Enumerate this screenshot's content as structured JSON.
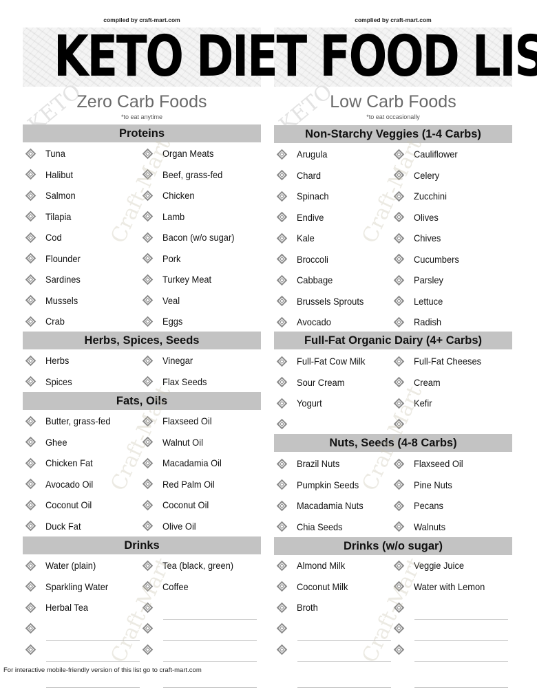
{
  "title": "KETO DIET FOOD LIST",
  "compiled_left": "compiled by craft-mart.com",
  "compiled_right": "complied by craft-mart.com",
  "watermark": "Craft-Mart",
  "keto_watermark": "KETO",
  "footer_note": "For interactive mobile-friendly version of this list go to craft-mart.com",
  "left": {
    "subtitle": "Zero Carb Foods",
    "note": "*to eat anytime",
    "sections": [
      {
        "title": "Proteins",
        "col1": [
          "Tuna",
          "Halibut",
          "Salmon",
          "Tilapia",
          "Cod",
          "Flounder",
          "Sardines",
          "Mussels",
          "Crab"
        ],
        "col2": [
          "Organ Meats",
          "Beef, grass-fed",
          "Chicken",
          "Lamb",
          "Bacon  (w/o sugar)",
          "Pork",
          "Turkey Meat",
          "Veal",
          "Eggs"
        ]
      },
      {
        "title": "Herbs, Spices, Seeds",
        "col1": [
          "Herbs",
          "Spices"
        ],
        "col2": [
          "Vinegar",
          "Flax Seeds"
        ]
      },
      {
        "title": "Fats, Oils",
        "col1": [
          "Butter, grass-fed",
          "Ghee",
          "Chicken Fat",
          "Avocado Oil",
          "Coconut Oil",
          "Duck Fat"
        ],
        "col2": [
          "Flaxseed Oil",
          "Walnut Oil",
          "Macadamia Oil",
          "Red Palm Oil",
          "Coconut Oil",
          "Olive Oil"
        ]
      },
      {
        "title": "Drinks",
        "col1": [
          "Water (plain)",
          "Sparkling Water",
          "Herbal Tea",
          "",
          ""
        ],
        "col2": [
          "Tea (black, green)",
          "Coffee",
          "",
          "",
          ""
        ]
      }
    ]
  },
  "right": {
    "subtitle": "Low Carb Foods",
    "note": "*to eat occasionally",
    "sections": [
      {
        "title": "Non-Starchy Veggies (1-4 Carbs)",
        "col1": [
          "Arugula",
          "Chard",
          "Spinach",
          "Endive",
          "Kale",
          "Broccoli",
          "Cabbage",
          "Brussels Sprouts",
          "Avocado"
        ],
        "col2": [
          "Cauliflower",
          "Celery",
          "Zucchini",
          "Olives",
          "Chives",
          "Cucumbers",
          "Parsley",
          "Lettuce",
          "Radish"
        ]
      },
      {
        "title": "Full-Fat Organic Dairy (4+ Carbs)",
        "col1": [
          "Full-Fat Cow Milk",
          "Sour Cream",
          "Yogurt",
          ""
        ],
        "col2": [
          "Full-Fat Cheeses",
          "Cream",
          "Kefir",
          ""
        ]
      },
      {
        "title": "Nuts, Seeds (4-8 Carbs)",
        "col1": [
          "Brazil Nuts",
          "Pumpkin Seeds",
          "Macadamia Nuts",
          "Chia Seeds"
        ],
        "col2": [
          "Flaxseed Oil",
          "Pine Nuts",
          "Pecans",
          "Walnuts"
        ]
      },
      {
        "title": "Drinks (w/o sugar)",
        "col1": [
          "Almond Milk",
          "Coconut Milk",
          "Broth",
          "",
          ""
        ],
        "col2": [
          "Veggie Juice",
          "Water with Lemon",
          "",
          "",
          ""
        ]
      }
    ]
  }
}
